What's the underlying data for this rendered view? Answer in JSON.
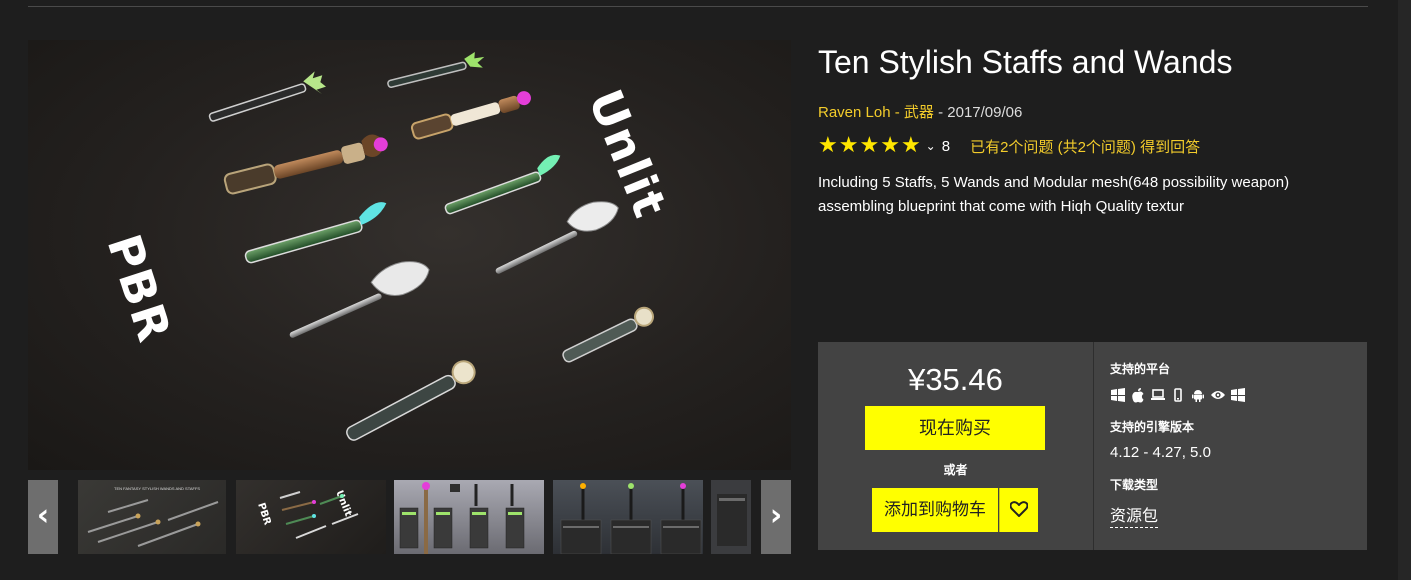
{
  "product": {
    "title": "Ten Stylish Staffs and Wands",
    "author": "Raven Loh",
    "separator1": " - ",
    "category": "武器",
    "separator2": " - ",
    "date": "2017/09/06",
    "rating_stars": 5,
    "rating_count": "8",
    "qa_text": "已有2个问题 (共2个问题) 得到回答",
    "description": "Including 5 Staffs, 5 Wands and Modular mesh(648 possibility weapon) assembling blueprint that come with Hiqh Quality textur"
  },
  "gallery": {
    "hero_text_left": "PBR",
    "hero_text_right": "Unlit",
    "prev_icon": "chevron-left-icon",
    "next_icon": "chevron-right-icon",
    "prev_glyph": "‹",
    "next_glyph": "›",
    "thumb_1_caption": "TEN FANTASY STYLISH WANDS AND STAFFS",
    "thumb_2_caption_a": "Unlit",
    "thumb_2_caption_b": "PBR"
  },
  "purchase": {
    "price": "¥35.46",
    "buy_label": "现在购买",
    "or_label": "或者",
    "cart_label": "添加到购物车",
    "wishlist_icon": "heart-icon"
  },
  "specs": {
    "platforms_label": "支持的平台",
    "platform_icons": [
      "windows-icon",
      "apple-icon",
      "laptop-icon",
      "mobile-icon",
      "android-icon",
      "vr-eye-icon",
      "windows-store-icon"
    ],
    "engine_label": "支持的引擎版本",
    "engine_versions": "4.12 - 4.27, 5.0",
    "download_label": "下载类型",
    "download_type": "资源包"
  },
  "colors": {
    "accent_yellow": "#ffff00",
    "link_gold": "#f3cc2b",
    "star_yellow": "#ffe600",
    "panel_bg": "#434343",
    "page_bg": "#1e1e1e"
  }
}
